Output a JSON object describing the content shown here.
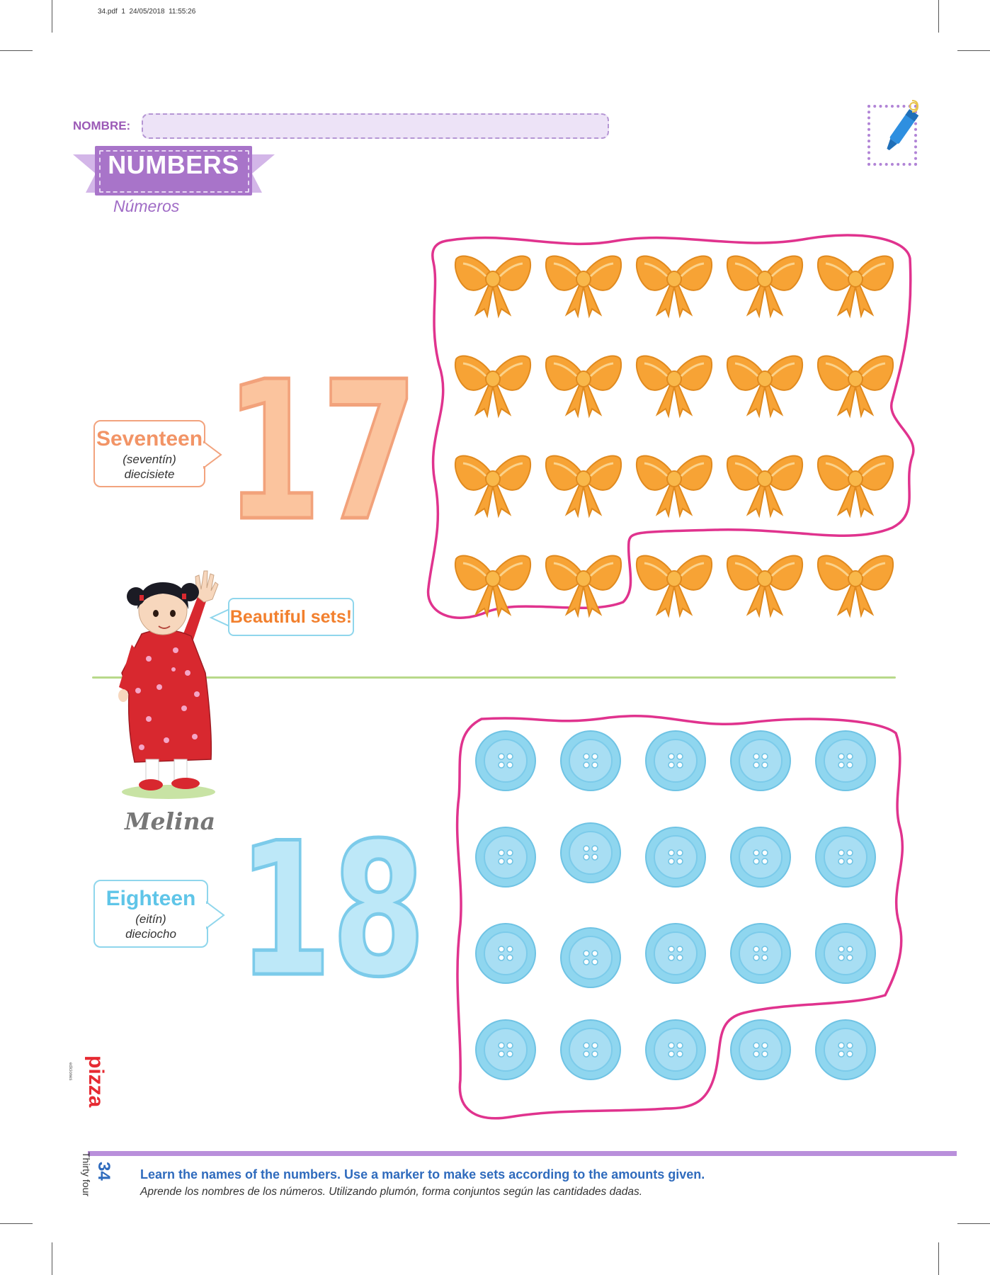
{
  "print_header": "34.pdf  1  24/05/2018  11:55:26",
  "name_label": "NOMBRE:",
  "title": {
    "en": "NUMBERS",
    "es": "Números"
  },
  "sections": [
    {
      "number": "17",
      "word": "Seventeen",
      "pronunciation": "(seventín)",
      "spanish": "diecisiete",
      "object": "bow",
      "object_count": 20,
      "color": "#f7a335"
    },
    {
      "number": "18",
      "word": "Eighteen",
      "pronunciation": "(eitín)",
      "spanish": "dieciocho",
      "object": "button",
      "object_count": 20,
      "color": "#8fd6ef"
    }
  ],
  "speech": "Beautiful sets!",
  "character_name": "Melina",
  "instructions": {
    "en": "Learn the names of the numbers. Use a marker to make sets according to the amounts given.",
    "es": "Aprende los nombres de los números. Utilizando plumón, forma conjuntos según las cantidades dadas."
  },
  "page": {
    "number": "34",
    "word": "Thirty four"
  },
  "logo": {
    "text": "pizza",
    "sub": "ediciones"
  },
  "icons": {
    "marker": "marker-icon"
  },
  "colors": {
    "set_outline": "#e0338e",
    "purple": "#a874c9"
  }
}
